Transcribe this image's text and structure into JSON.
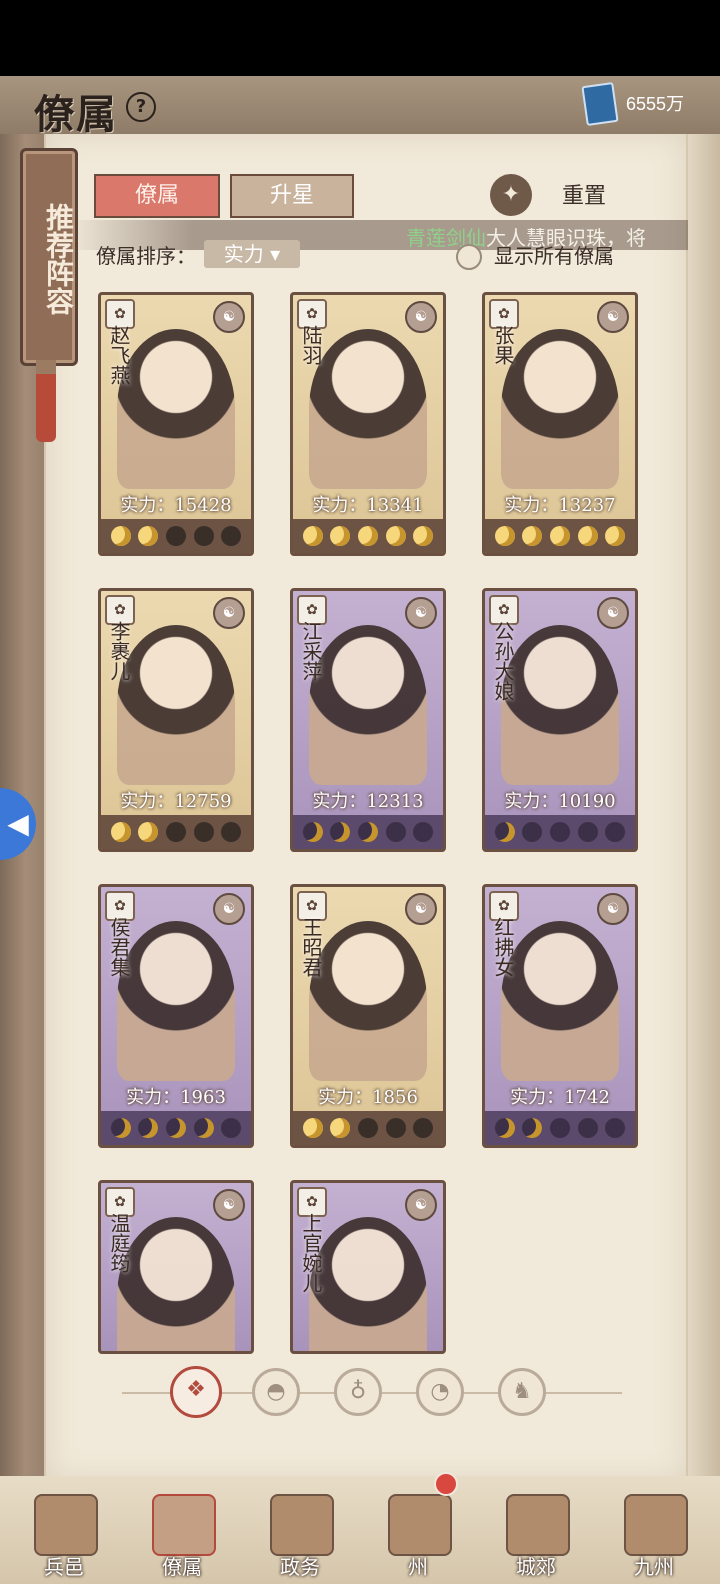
{
  "header": {
    "title": "僚属",
    "currency_value": "6555万"
  },
  "side_banner": {
    "label": "推荐阵容"
  },
  "tabs": [
    {
      "label": "僚属",
      "active": true
    },
    {
      "label": "升星",
      "active": false
    }
  ],
  "reset_button": {
    "label": "重置"
  },
  "marquee": {
    "name": "青莲剑仙",
    "message": "大人慧眼识珠，将"
  },
  "sort": {
    "label": "僚属排序：",
    "selected": "实力 ▾"
  },
  "show_all": {
    "label": "显示所有僚属"
  },
  "power_prefix": "实力：",
  "cards": [
    {
      "name": "赵飞燕",
      "power": "15428",
      "stars_on": 2,
      "frame": "gold"
    },
    {
      "name": "陆羽",
      "power": "13341",
      "stars_on": 5,
      "frame": "gold"
    },
    {
      "name": "张果",
      "power": "13237",
      "stars_on": 5,
      "frame": "gold"
    },
    {
      "name": "李裹儿",
      "power": "12759",
      "stars_on": 2,
      "frame": "gold"
    },
    {
      "name": "江采萍",
      "power": "12313",
      "stars_on": 3,
      "frame": "purple"
    },
    {
      "name": "公孙大娘",
      "power": "10190",
      "stars_on": 1,
      "frame": "purple"
    },
    {
      "name": "侯君集",
      "power": "1963",
      "stars_on": 4,
      "frame": "purple"
    },
    {
      "name": "王昭君",
      "power": "1856",
      "stars_on": 2,
      "frame": "gold"
    },
    {
      "name": "红拂女",
      "power": "1742",
      "stars_on": 2,
      "frame": "purple"
    },
    {
      "name": "温庭筠",
      "power": "",
      "stars_on": 0,
      "frame": "purple"
    },
    {
      "name": "上官婉儿",
      "power": "",
      "stars_on": 0,
      "frame": "purple"
    }
  ],
  "bottom_nav": [
    {
      "label": "兵邑",
      "active": false
    },
    {
      "label": "僚属",
      "active": true
    },
    {
      "label": "政务",
      "active": false
    },
    {
      "label": "州",
      "active": false,
      "badge": true
    },
    {
      "label": "城郊",
      "active": false
    },
    {
      "label": "九州",
      "active": false
    }
  ]
}
